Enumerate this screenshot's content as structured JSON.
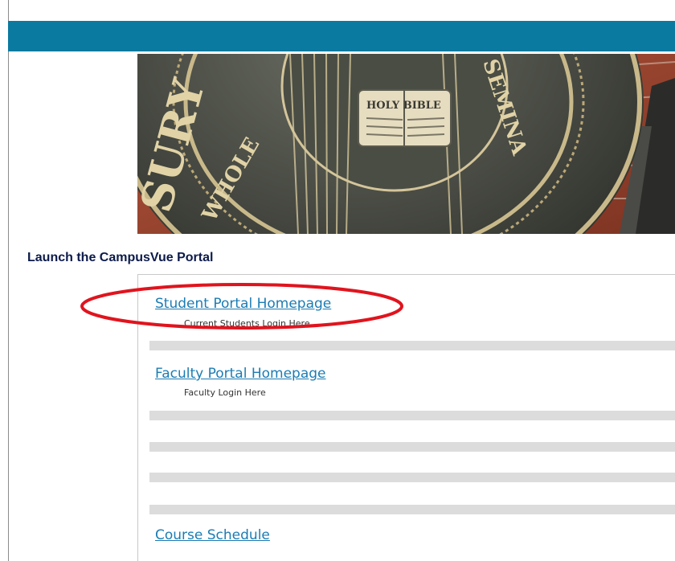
{
  "heading": "Launch the CampusVue Portal",
  "banner": {
    "seal_text_1": "HOLY BIBLE",
    "seal_text_2": "SEMINA",
    "seal_text_3": "WHOLE",
    "seal_text_4": "SURY"
  },
  "links": [
    {
      "label": "Student Portal Homepage",
      "description": "Current Students Login Here"
    },
    {
      "label": "Faculty Portal Homepage",
      "description": "Faculty Login Here"
    },
    {
      "label": "Course Schedule"
    }
  ],
  "colors": {
    "topbar": "#0a7aa0",
    "link": "#1b7cb4",
    "heading": "#0c1a4a",
    "annotation": "#e0141e",
    "separator": "#dcdcdc"
  }
}
